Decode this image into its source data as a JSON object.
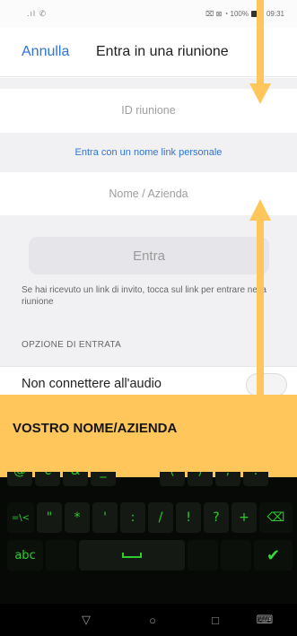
{
  "status_bar": {
    "signal": "⁠.ıl ✆",
    "right_text": "⌧ ⊠ ◔ 100%",
    "time": "09:31"
  },
  "header": {
    "cancel_label": "Annulla",
    "title": "Entra in una riunione"
  },
  "meeting_id": {
    "placeholder": "ID riunione"
  },
  "personal_link": {
    "label": "Entra con un nome link personale"
  },
  "name_field": {
    "placeholder": "Nome / Azienda"
  },
  "join_button": {
    "label": "Entra"
  },
  "hint_text": "Se hai ricevuto un link di invito, tocca sul link per entrare nella riunione",
  "options": {
    "section_label": "OPZIONE DI ENTRATA",
    "audio_label": "Non connettere all'audio",
    "audio_toggle_on": false
  },
  "annotation": {
    "text": "VOSTRO NOME/AZIENDA",
    "arrow_color": "#fec65b"
  },
  "keyboard": {
    "row_partial": [
      "@",
      "€",
      "&",
      "_",
      "(",
      ")",
      ";",
      "."
    ],
    "row_symbols": [
      "=\\<",
      "\"",
      "*",
      "'",
      ":",
      "/",
      "!",
      "?",
      "+",
      "⌫"
    ],
    "row_bottom": {
      "mode_label": "abc",
      "space_label": "space",
      "enter_icon": "✔"
    },
    "accent_color": "#2ecc2e"
  },
  "nav_bar": {
    "back": "▽",
    "home": "○",
    "recents": "□",
    "keyboard": "⌨"
  }
}
